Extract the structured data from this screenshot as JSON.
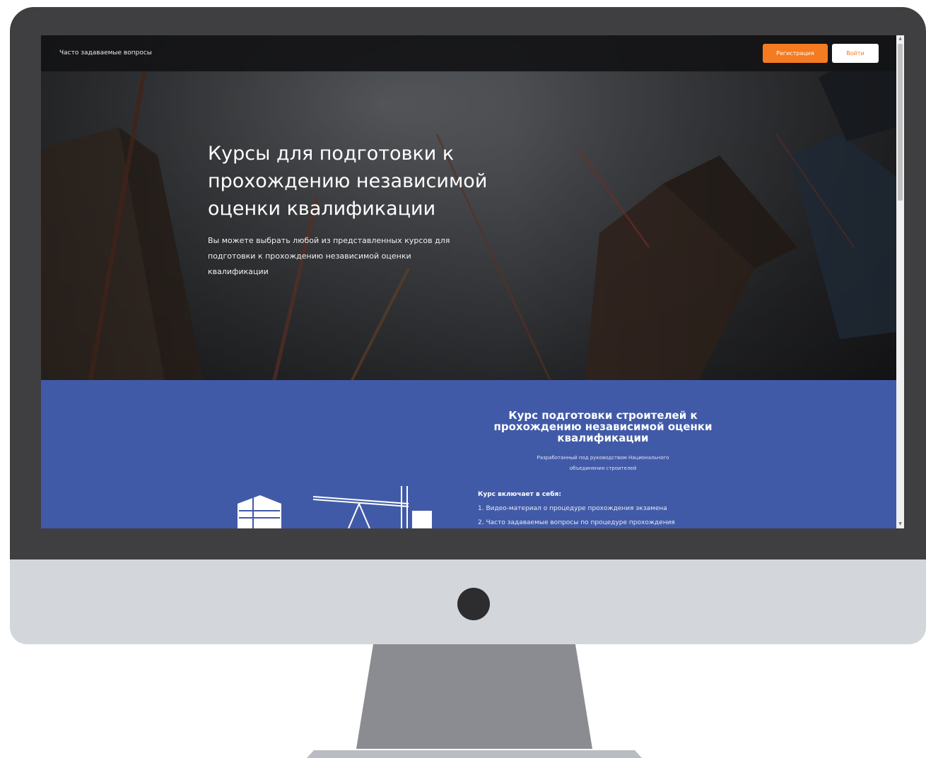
{
  "header": {
    "faq_link": "Часто задаваемые вопросы",
    "register_button": "Регистрация",
    "login_button": "Войти"
  },
  "hero": {
    "title": "Курсы для подготовки к прохождению независимой оценки квалификации",
    "subtitle": "Вы можете выбрать любой из представленных курсов для подготовки к прохождению независимой оценки квалификации"
  },
  "course": {
    "title": "Курс подготовки строителей к прохождению независимой оценки квалификации",
    "subtitle": "Разработанный под руководством Национального объединения строителей",
    "includes_title": "Курс включает в себя:",
    "items": [
      "1. Видео-материал о процедуре прохождения экзамена",
      "2. Часто задаваемые вопросы по процедуре прохождения"
    ]
  },
  "colors": {
    "accent_orange": "#f47b20",
    "course_blue": "#415aa8",
    "bezel": "#3f3f41",
    "chin": "#d3d6db"
  },
  "icons": [
    "building-icon",
    "crane-icon",
    "chevron-up-icon",
    "chevron-down-icon"
  ]
}
